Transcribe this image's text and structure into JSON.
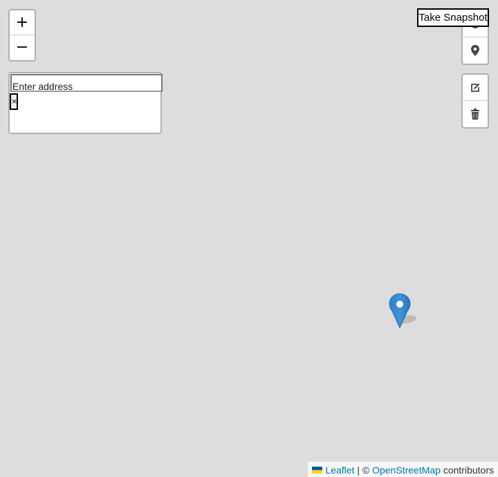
{
  "zoom_control": {
    "zoom_in_label": "+",
    "zoom_out_label": "−"
  },
  "geocoder": {
    "placeholder": "Enter address",
    "clear_label": "×"
  },
  "snapshot": {
    "label": "Take Snapshot"
  },
  "map_tools": {
    "icons": [
      "crosshair-icon",
      "location-pin-icon"
    ]
  },
  "draw_tools": {
    "icons": [
      "edit-icon",
      "trash-icon"
    ]
  },
  "marker": {
    "icon": "map-marker-icon",
    "color": "#2b82cb"
  },
  "attribution": {
    "leaflet": "Leaflet",
    "separator": "| ©",
    "osm": "OpenStreetMap",
    "suffix": "contributors"
  },
  "colors": {
    "map_background": "#dddddd",
    "link": "#0078a8"
  }
}
